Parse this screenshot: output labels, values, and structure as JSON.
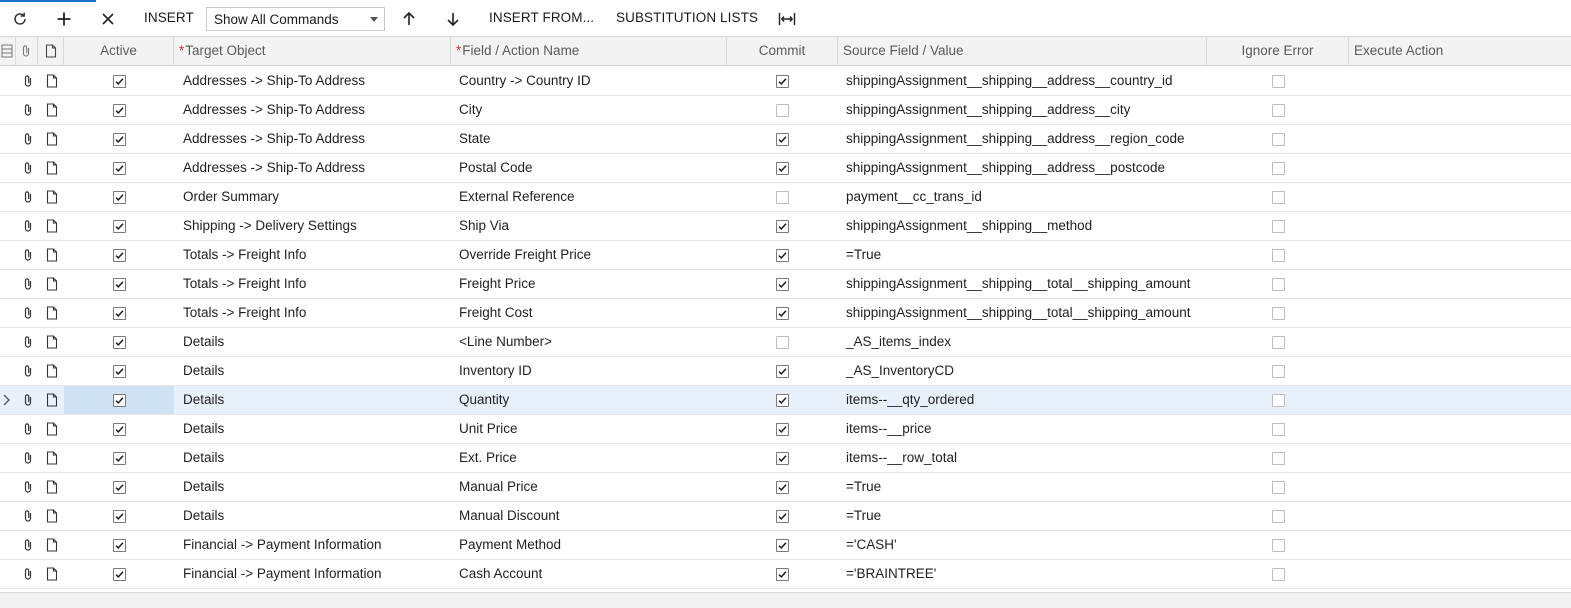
{
  "toolbar": {
    "refresh_icon": "refresh-icon",
    "add_icon": "plus-icon",
    "delete_icon": "close-icon",
    "insert_label": "INSERT",
    "command_filter_value": "Show All Commands",
    "move_up_icon": "arrow-up-icon",
    "move_down_icon": "arrow-down-icon",
    "insert_from_label": "INSERT FROM...",
    "substitution_lists_label": "SUBSTITUTION LISTS",
    "fit_columns_icon": "fit-columns-icon"
  },
  "grid": {
    "headers": {
      "active": "Active",
      "target_object": "Target Object",
      "field_action": "Field / Action Name",
      "commit": "Commit",
      "source_field": "Source Field / Value",
      "ignore_error": "Ignore Error",
      "execute_action": "Execute Action"
    },
    "rows": [
      {
        "active": true,
        "target": "Addresses -> Ship-To Address",
        "field": "Country -> Country ID",
        "commit": true,
        "source": "shippingAssignment__shipping__address__country_id",
        "ignore": false
      },
      {
        "active": true,
        "target": "Addresses -> Ship-To Address",
        "field": "City",
        "commit": false,
        "source": "shippingAssignment__shipping__address__city",
        "ignore": false
      },
      {
        "active": true,
        "target": "Addresses -> Ship-To Address",
        "field": "State",
        "commit": true,
        "source": "shippingAssignment__shipping__address__region_code",
        "ignore": false
      },
      {
        "active": true,
        "target": "Addresses -> Ship-To Address",
        "field": "Postal Code",
        "commit": true,
        "source": "shippingAssignment__shipping__address__postcode",
        "ignore": false
      },
      {
        "active": true,
        "target": "Order Summary",
        "field": "External Reference",
        "commit": false,
        "source": "payment__cc_trans_id",
        "ignore": false
      },
      {
        "active": true,
        "target": "Shipping -> Delivery Settings",
        "field": "Ship Via",
        "commit": true,
        "source": "shippingAssignment__shipping__method",
        "ignore": false
      },
      {
        "active": true,
        "target": "Totals -> Freight Info",
        "field": "Override Freight Price",
        "commit": true,
        "source": "=True",
        "ignore": false
      },
      {
        "active": true,
        "target": "Totals -> Freight Info",
        "field": "Freight Price",
        "commit": true,
        "source": "shippingAssignment__shipping__total__shipping_amount",
        "ignore": false
      },
      {
        "active": true,
        "target": "Totals -> Freight Info",
        "field": "Freight Cost",
        "commit": true,
        "source": "shippingAssignment__shipping__total__shipping_amount",
        "ignore": false
      },
      {
        "active": true,
        "target": "Details",
        "field": "<Line Number>",
        "commit": false,
        "source": "_AS_items_index",
        "ignore": false
      },
      {
        "active": true,
        "target": "Details",
        "field": "Inventory ID",
        "commit": true,
        "source": "_AS_InventoryCD",
        "ignore": false
      },
      {
        "active": true,
        "target": "Details",
        "field": "Quantity",
        "commit": true,
        "source": "items--__qty_ordered",
        "ignore": false,
        "selected": true
      },
      {
        "active": true,
        "target": "Details",
        "field": "Unit Price",
        "commit": true,
        "source": "items--__price",
        "ignore": false
      },
      {
        "active": true,
        "target": "Details",
        "field": "Ext. Price",
        "commit": true,
        "source": "items--__row_total",
        "ignore": false
      },
      {
        "active": true,
        "target": "Details",
        "field": "Manual Price",
        "commit": true,
        "source": "=True",
        "ignore": false
      },
      {
        "active": true,
        "target": "Details",
        "field": "Manual Discount",
        "commit": true,
        "source": "=True",
        "ignore": false
      },
      {
        "active": true,
        "target": "Financial -> Payment Information",
        "field": "Payment Method",
        "commit": true,
        "source": "='CASH'",
        "ignore": false
      },
      {
        "active": true,
        "target": "Financial -> Payment Information",
        "field": "Cash Account",
        "commit": true,
        "source": "='BRAINTREE'",
        "ignore": false
      }
    ]
  }
}
